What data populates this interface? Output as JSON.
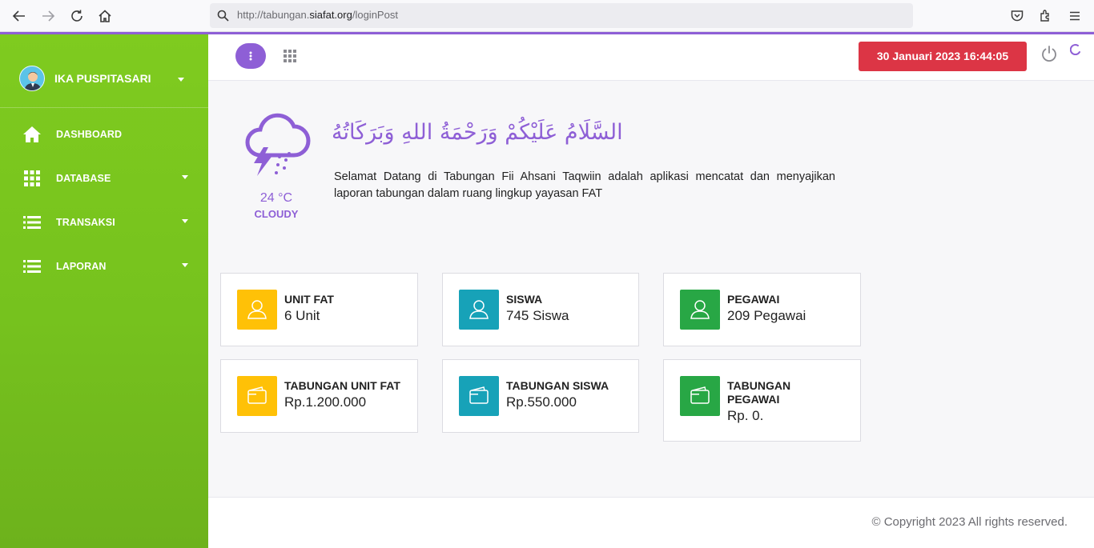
{
  "browser": {
    "url_prefix": "http://tabungan.",
    "url_domain": "siafat.org",
    "url_path": "/loginPost"
  },
  "sidebar": {
    "user_name": "IKA PUSPITASARI",
    "items": [
      {
        "label": "DASHBOARD",
        "icon": "home-icon"
      },
      {
        "label": "DATABASE",
        "icon": "grid-icon"
      },
      {
        "label": "TRANSAKSI",
        "icon": "list-icon"
      },
      {
        "label": "LAPORAN",
        "icon": "list-icon"
      }
    ]
  },
  "topbar": {
    "datetime": "30 Januari 2023 16:44:05"
  },
  "welcome": {
    "weather_temp": "24 °C",
    "weather_desc": "CLOUDY",
    "greeting_arabic": "السَّلَامُ عَلَيْكُمْ وَرَحْمَةُ اللهِ وَبَرَكَاتُهُ",
    "text": "Selamat Datang di Tabungan Fii Ahsani Taqwiin adalah aplikasi mencatat dan menyajikan laporan tabungan dalam ruang lingkup yayasan FAT"
  },
  "cards": [
    {
      "title": "UNIT FAT",
      "value": "6 Unit",
      "color": "#ffc107",
      "icon": "user-icon"
    },
    {
      "title": "SISWA",
      "value": "745 Siswa",
      "color": "#17a2b8",
      "icon": "user-icon"
    },
    {
      "title": "PEGAWAI",
      "value": "209 Pegawai",
      "color": "#28a745",
      "icon": "user-icon"
    },
    {
      "title": "TABUNGAN UNIT FAT",
      "value": "Rp.1.200.000",
      "color": "#ffc107",
      "icon": "wallet-icon"
    },
    {
      "title": "TABUNGAN SISWA",
      "value": "Rp.550.000",
      "color": "#17a2b8",
      "icon": "wallet-icon"
    },
    {
      "title": "TABUNGAN PEGAWAI",
      "value": "Rp. 0.",
      "color": "#28a745",
      "icon": "wallet-icon"
    }
  ],
  "footer": {
    "copyright": "© Copyright 2023 All rights reserved."
  },
  "colors": {
    "accent": "#8e5fd6",
    "sidebar_green": "#76c21e",
    "date_badge": "#dc3545"
  }
}
